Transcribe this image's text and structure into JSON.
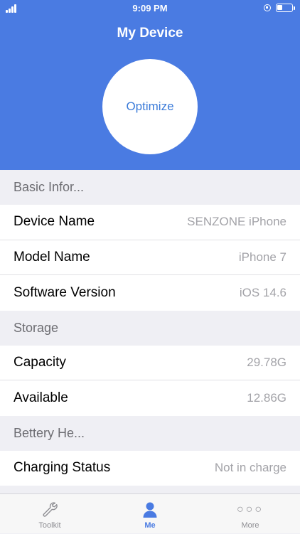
{
  "status_bar": {
    "time": "9:09 PM",
    "signal_icon": "cellular-signal-icon",
    "lock_icon": "orientation-lock-icon",
    "battery_icon": "battery-icon",
    "battery_level": 0.35
  },
  "header": {
    "title": "My Device",
    "optimize_label": "Optimize",
    "background_color": "#4a7be2"
  },
  "sections": {
    "basic": {
      "title": "Basic Infor...",
      "rows": [
        {
          "label": "Device Name",
          "value": "SENZONE iPhone"
        },
        {
          "label": "Model Name",
          "value": "iPhone 7"
        },
        {
          "label": "Software Version",
          "value": "iOS 14.6"
        }
      ]
    },
    "storage": {
      "title": "Storage",
      "rows": [
        {
          "label": "Capacity",
          "value": "29.78G"
        },
        {
          "label": "Available",
          "value": "12.86G"
        }
      ]
    },
    "battery": {
      "title": "Bettery He...",
      "rows": [
        {
          "label": "Charging Status",
          "value": "Not in charge"
        }
      ]
    }
  },
  "tabbar": {
    "tabs": [
      {
        "label": "Toolkit",
        "icon": "wrench-icon",
        "active": false
      },
      {
        "label": "Me",
        "icon": "person-icon",
        "active": true
      },
      {
        "label": "More",
        "icon": "more-dots-icon",
        "active": false
      }
    ],
    "more_glyph": "○○○"
  }
}
